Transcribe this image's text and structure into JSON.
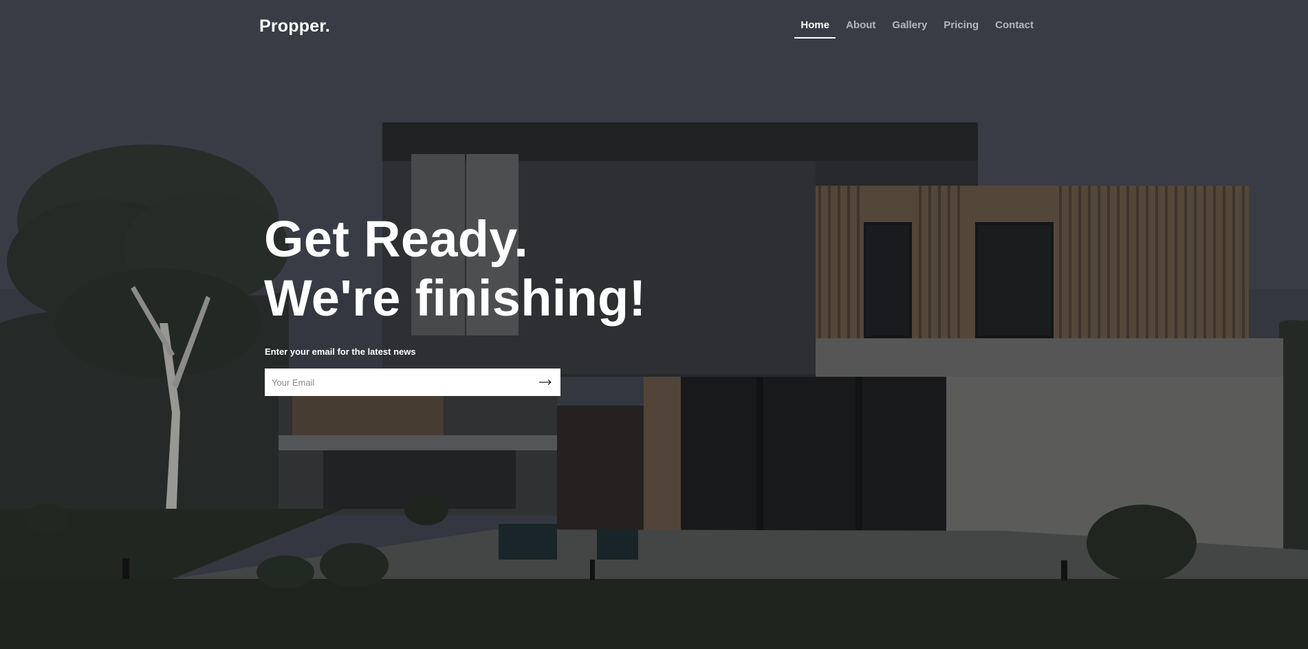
{
  "header": {
    "logo": "Propper.",
    "nav": [
      {
        "label": "Home",
        "active": true
      },
      {
        "label": "About",
        "active": false
      },
      {
        "label": "Gallery",
        "active": false
      },
      {
        "label": "Pricing",
        "active": false
      },
      {
        "label": "Contact",
        "active": false
      }
    ]
  },
  "hero": {
    "headline_line1": "Get Ready.",
    "headline_line2": "We're finishing!",
    "subtext": "Enter your email for the latest news",
    "email_placeholder": "Your Email",
    "submit_icon": "arrow-right-icon"
  },
  "colors": {
    "text": "#ffffff",
    "nav_inactive": "#b4b7bc",
    "input_bg": "#ffffff"
  }
}
